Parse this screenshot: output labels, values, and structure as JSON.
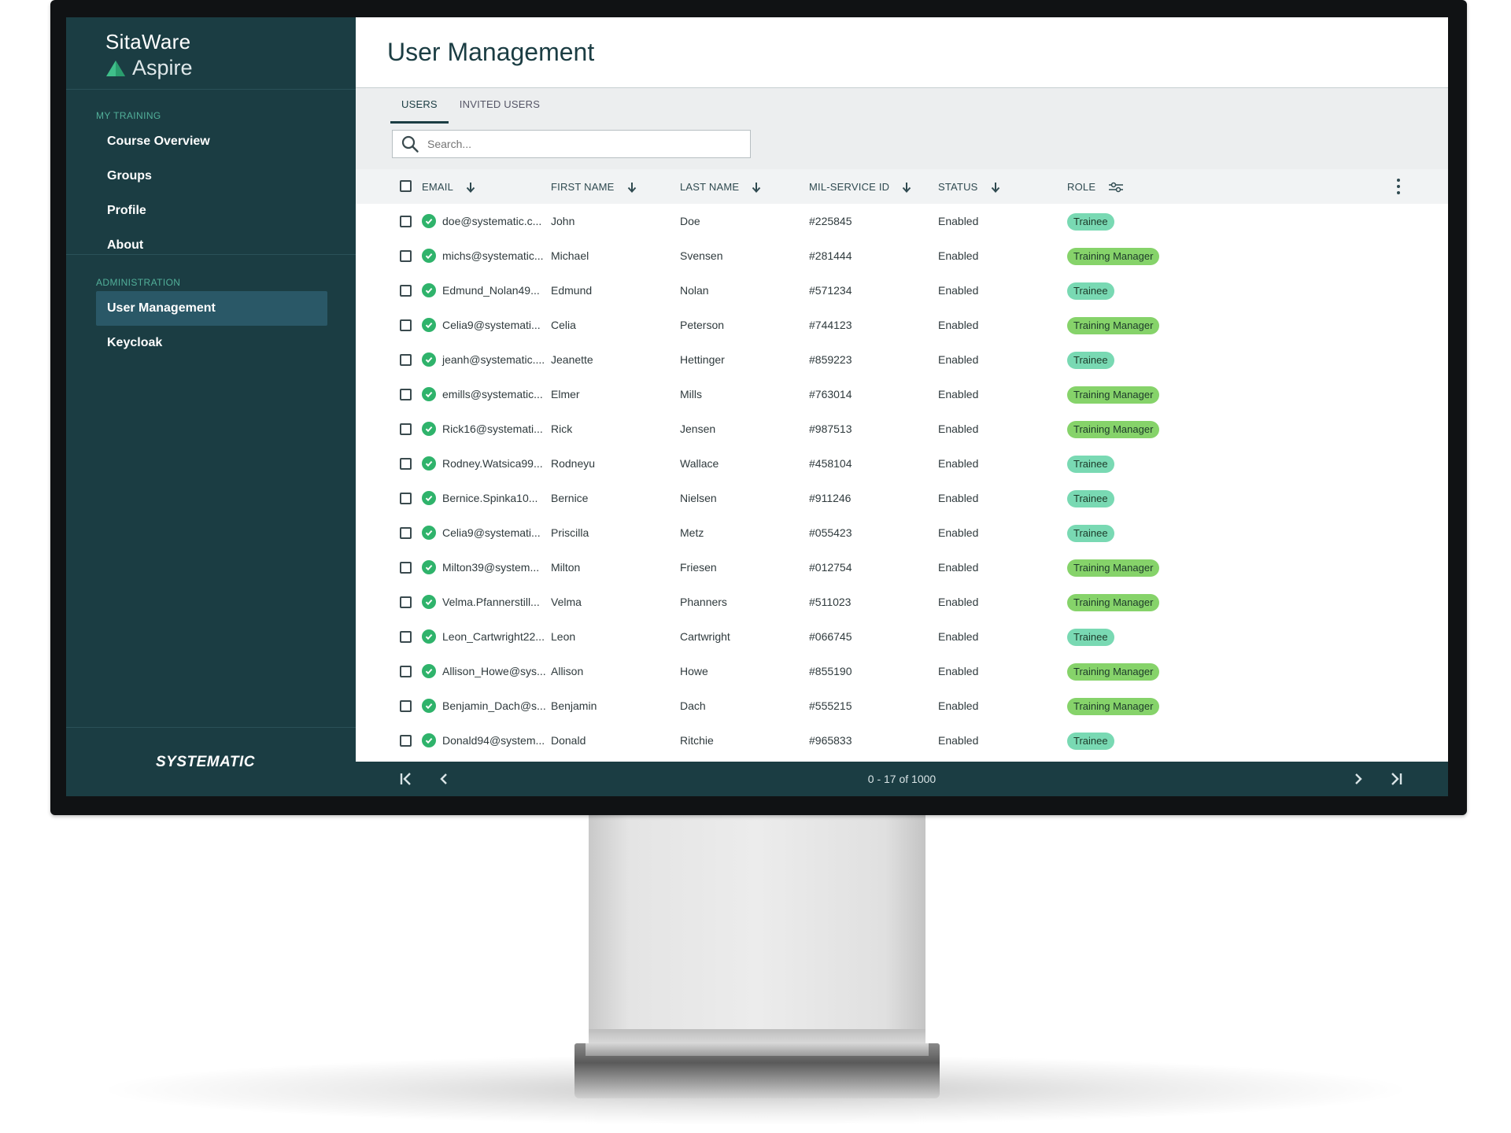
{
  "app": {
    "brand_line1": "SitaWare",
    "brand_line2": "Aspire",
    "footer_logo": "SYSTEMATIC"
  },
  "colors": {
    "sidebar_bg": "#1b3d43",
    "accent": "#52b09a",
    "enabled_check": "#2fb36b",
    "trainee_badge": "#79d9b3",
    "manager_badge": "#86d36a"
  },
  "sidebar": {
    "training_title": "MY TRAINING",
    "training_items": [
      "Course Overview",
      "Groups",
      "Profile",
      "About"
    ],
    "admin_title": "ADMINISTRATION",
    "admin_items": [
      "User Management",
      "Keycloak"
    ],
    "active_item": "User Management"
  },
  "page": {
    "title": "User Management",
    "tabs": [
      "USERS",
      "INVITED USERS"
    ],
    "active_tab": "USERS",
    "search_placeholder": "Search..."
  },
  "table": {
    "columns": [
      "EMAIL",
      "FIRST NAME",
      "LAST NAME",
      "MIL-SERVICE ID",
      "STATUS",
      "ROLE"
    ],
    "rows": [
      {
        "email": "doe@systematic.c...",
        "first": "John",
        "last": "Doe",
        "id": "#225845",
        "status": "Enabled",
        "role": "Trainee"
      },
      {
        "email": "michs@systematic...",
        "first": "Michael",
        "last": "Svensen",
        "id": "#281444",
        "status": "Enabled",
        "role": "Training Manager"
      },
      {
        "email": "Edmund_Nolan49...",
        "first": "Edmund",
        "last": "Nolan",
        "id": "#571234",
        "status": "Enabled",
        "role": "Trainee"
      },
      {
        "email": "Celia9@systemati...",
        "first": "Celia",
        "last": "Peterson",
        "id": "#744123",
        "status": "Enabled",
        "role": "Training Manager"
      },
      {
        "email": "jeanh@systematic....",
        "first": "Jeanette",
        "last": "Hettinger",
        "id": "#859223",
        "status": "Enabled",
        "role": "Trainee"
      },
      {
        "email": "emills@systematic...",
        "first": "Elmer",
        "last": "Mills",
        "id": "#763014",
        "status": "Enabled",
        "role": "Training Manager"
      },
      {
        "email": "Rick16@systemati...",
        "first": "Rick",
        "last": "Jensen",
        "id": "#987513",
        "status": "Enabled",
        "role": "Training Manager"
      },
      {
        "email": "Rodney.Watsica99...",
        "first": "Rodneyu",
        "last": "Wallace",
        "id": "#458104",
        "status": "Enabled",
        "role": "Trainee"
      },
      {
        "email": "Bernice.Spinka10...",
        "first": "Bernice",
        "last": "Nielsen",
        "id": "#911246",
        "status": "Enabled",
        "role": "Trainee"
      },
      {
        "email": "Celia9@systemati...",
        "first": "Priscilla",
        "last": "Metz",
        "id": "#055423",
        "status": "Enabled",
        "role": "Trainee"
      },
      {
        "email": "Milton39@system...",
        "first": "Milton",
        "last": "Friesen",
        "id": "#012754",
        "status": "Enabled",
        "role": "Training Manager"
      },
      {
        "email": "Velma.Pfannerstill...",
        "first": "Velma",
        "last": "Phanners",
        "id": "#511023",
        "status": "Enabled",
        "role": "Training Manager"
      },
      {
        "email": "Leon_Cartwright22...",
        "first": "Leon",
        "last": "Cartwright",
        "id": "#066745",
        "status": "Enabled",
        "role": "Trainee"
      },
      {
        "email": "Allison_Howe@sys...",
        "first": "Allison",
        "last": "Howe",
        "id": "#855190",
        "status": "Enabled",
        "role": "Training Manager"
      },
      {
        "email": "Benjamin_Dach@s...",
        "first": "Benjamin",
        "last": "Dach",
        "id": "#555215",
        "status": "Enabled",
        "role": "Training Manager"
      },
      {
        "email": "Donald94@system...",
        "first": "Donald",
        "last": "Ritchie",
        "id": "#965833",
        "status": "Enabled",
        "role": "Trainee"
      }
    ]
  },
  "pagination": {
    "range_text": "0 - 17 of 1000"
  }
}
